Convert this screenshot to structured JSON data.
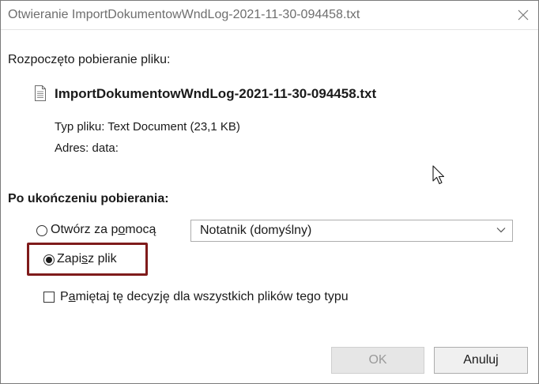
{
  "window": {
    "title": "Otwieranie ImportDokumentowWndLog-2021-11-30-094458.txt"
  },
  "intro": "Rozpoczęto pobieranie pliku:",
  "file": {
    "name": "ImportDokumentowWndLog-2021-11-30-094458.txt",
    "type_label": "Typ pliku:",
    "type_value": "Text Document (23,1 KB)",
    "address_label": "Adres:",
    "address_value": "data:",
    "icon": "text-file-icon"
  },
  "after_download": {
    "heading": "Po ukończeniu pobierania:",
    "open_with": {
      "label_before": "Otwórz za p",
      "label_underlined": "o",
      "label_after": "mocą",
      "selected": false,
      "app": "Notatnik (domyślny)"
    },
    "save_file": {
      "label_before": "Zapi",
      "label_underlined": "s",
      "label_after": "z plik",
      "selected": true
    },
    "remember": {
      "label_before": "P",
      "label_underlined": "a",
      "label_after": "miętaj tę decyzję dla wszystkich plików tego typu",
      "checked": false
    }
  },
  "buttons": {
    "ok": "OK",
    "cancel": "Anuluj"
  },
  "colors": {
    "highlight": "#7f1b1b",
    "disabled_text": "#9a9a9a"
  }
}
